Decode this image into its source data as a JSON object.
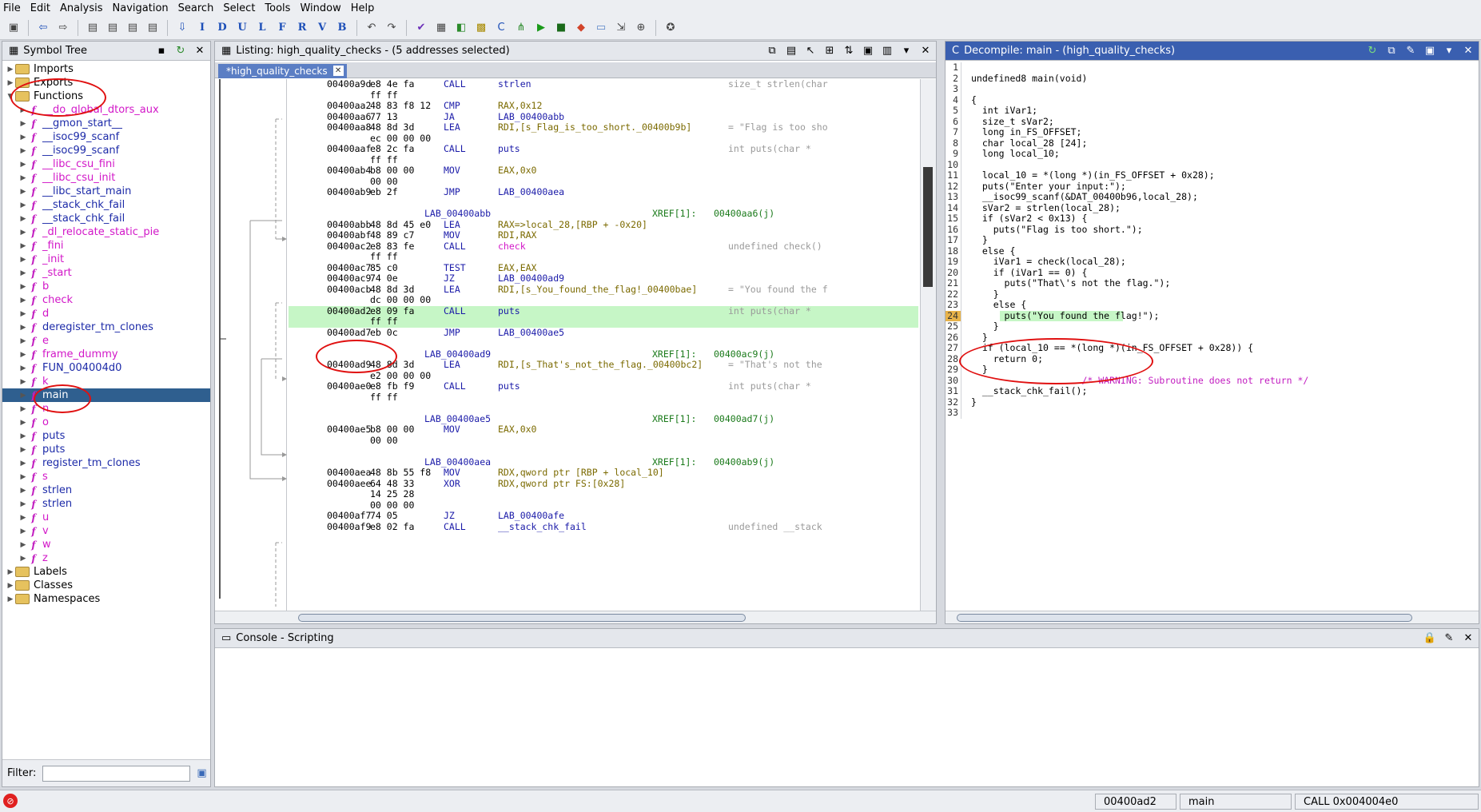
{
  "menu": [
    "File",
    "Edit",
    "Analysis",
    "Navigation",
    "Search",
    "Select",
    "Tools",
    "Window",
    "Help"
  ],
  "symbol_tree": {
    "title": "Symbol Tree",
    "folders_top": [
      "Imports",
      "Exports",
      "Functions"
    ],
    "functions": [
      {
        "name": "__do_global_dtors_aux",
        "color": "pink"
      },
      {
        "name": "__gmon_start__",
        "color": "navy"
      },
      {
        "name": "__isoc99_scanf",
        "color": "navy"
      },
      {
        "name": "__isoc99_scanf",
        "color": "navy"
      },
      {
        "name": "__libc_csu_fini",
        "color": "pink"
      },
      {
        "name": "__libc_csu_init",
        "color": "pink"
      },
      {
        "name": "__libc_start_main",
        "color": "navy"
      },
      {
        "name": "__stack_chk_fail",
        "color": "navy"
      },
      {
        "name": "__stack_chk_fail",
        "color": "navy"
      },
      {
        "name": "_dl_relocate_static_pie",
        "color": "pink"
      },
      {
        "name": "_fini",
        "color": "pink"
      },
      {
        "name": "_init",
        "color": "pink"
      },
      {
        "name": "_start",
        "color": "pink"
      },
      {
        "name": "b",
        "color": "pink"
      },
      {
        "name": "check",
        "color": "pink"
      },
      {
        "name": "d",
        "color": "pink"
      },
      {
        "name": "deregister_tm_clones",
        "color": "navy"
      },
      {
        "name": "e",
        "color": "pink"
      },
      {
        "name": "frame_dummy",
        "color": "pink"
      },
      {
        "name": "FUN_004004d0",
        "color": "navy"
      },
      {
        "name": "k",
        "color": "pink"
      },
      {
        "name": "main",
        "color": "sel"
      },
      {
        "name": "n",
        "color": "pink"
      },
      {
        "name": "o",
        "color": "pink"
      },
      {
        "name": "puts",
        "color": "navy"
      },
      {
        "name": "puts",
        "color": "navy"
      },
      {
        "name": "register_tm_clones",
        "color": "navy"
      },
      {
        "name": "s",
        "color": "pink"
      },
      {
        "name": "strlen",
        "color": "navy"
      },
      {
        "name": "strlen",
        "color": "navy"
      },
      {
        "name": "u",
        "color": "pink"
      },
      {
        "name": "v",
        "color": "pink"
      },
      {
        "name": "w",
        "color": "pink"
      },
      {
        "name": "z",
        "color": "pink"
      }
    ],
    "folders_bottom": [
      "Labels",
      "Classes",
      "Namespaces"
    ],
    "filter_label": "Filter:"
  },
  "listing": {
    "title": "Listing:  high_quality_checks - (5 addresses selected)",
    "tab": "*high_quality_checks",
    "lines": [
      {
        "a": "00400a9d",
        "b": "e8 4e fa",
        "m": "CALL",
        "o": "strlen",
        "c": "size_t strlen(char"
      },
      {
        "a": "",
        "b": "ff ff",
        "m": "",
        "o": "",
        "c": ""
      },
      {
        "a": "00400aa2",
        "b": "48 83 f8 12",
        "m": "CMP",
        "o": "RAX,0x12",
        "c": ""
      },
      {
        "a": "00400aa6",
        "b": "77 13",
        "m": "JA",
        "o": "LAB_00400abb",
        "c": ""
      },
      {
        "a": "00400aa8",
        "b": "48 8d 3d",
        "m": "LEA",
        "o": "RDI,[s_Flag_is_too_short._00400b9b]",
        "c": "= \"Flag is too sho"
      },
      {
        "a": "",
        "b": "ec 00 00 00",
        "m": "",
        "o": "",
        "c": ""
      },
      {
        "a": "00400aaf",
        "b": "e8 2c fa",
        "m": "CALL",
        "o": "puts",
        "c": "int puts(char *"
      },
      {
        "a": "",
        "b": "ff ff",
        "m": "",
        "o": "",
        "c": ""
      },
      {
        "a": "00400ab4",
        "b": "b8 00 00",
        "m": "MOV",
        "o": "EAX,0x0",
        "c": ""
      },
      {
        "a": "",
        "b": "00 00",
        "m": "",
        "o": "",
        "c": ""
      },
      {
        "a": "00400ab9",
        "b": "eb 2f",
        "m": "JMP",
        "o": "LAB_00400aea",
        "c": ""
      },
      {
        "blank": true
      },
      {
        "lab": "LAB_00400abb",
        "xr": "XREF[1]:",
        "xra": "00400aa6(j)"
      },
      {
        "a": "00400abb",
        "b": "48 8d 45 e0",
        "m": "LEA",
        "o": "RAX=>local_28,[RBP + -0x20]",
        "c": ""
      },
      {
        "a": "00400abf",
        "b": "48 89 c7",
        "m": "MOV",
        "o": "RDI,RAX",
        "c": ""
      },
      {
        "a": "00400ac2",
        "b": "e8 83 fe",
        "m": "CALL",
        "o": "check",
        "c": "undefined check()"
      },
      {
        "a": "",
        "b": "ff ff",
        "m": "",
        "o": "",
        "c": ""
      },
      {
        "a": "00400ac7",
        "b": "85 c0",
        "m": "TEST",
        "o": "EAX,EAX",
        "c": ""
      },
      {
        "a": "00400ac9",
        "b": "74 0e",
        "m": "JZ",
        "o": "LAB_00400ad9",
        "c": ""
      },
      {
        "a": "00400acb",
        "b": "48 8d 3d",
        "m": "LEA",
        "o": "RDI,[s_You_found_the_flag!_00400bae]",
        "c": "= \"You found the f"
      },
      {
        "a": "",
        "b": "dc 00 00 00",
        "m": "",
        "o": "",
        "c": ""
      },
      {
        "a": "00400ad2",
        "b": "e8 09 fa",
        "m": "CALL",
        "o": "puts",
        "c": "int puts(char *",
        "hl": true
      },
      {
        "a": "",
        "b": "ff ff",
        "m": "",
        "o": "",
        "c": "",
        "hl": true
      },
      {
        "a": "00400ad7",
        "b": "eb 0c",
        "m": "JMP",
        "o": "LAB_00400ae5",
        "c": ""
      },
      {
        "blank": true
      },
      {
        "lab": "LAB_00400ad9",
        "xr": "XREF[1]:",
        "xra": "00400ac9(j)"
      },
      {
        "a": "00400ad9",
        "b": "48 8d 3d",
        "m": "LEA",
        "o": "RDI,[s_That's_not_the_flag._00400bc2]",
        "c": "= \"That's not the"
      },
      {
        "a": "",
        "b": "e2 00 00 00",
        "m": "",
        "o": "",
        "c": ""
      },
      {
        "a": "00400ae0",
        "b": "e8 fb f9",
        "m": "CALL",
        "o": "puts",
        "c": "int puts(char *"
      },
      {
        "a": "",
        "b": "ff ff",
        "m": "",
        "o": "",
        "c": ""
      },
      {
        "blank": true
      },
      {
        "lab": "LAB_00400ae5",
        "xr": "XREF[1]:",
        "xra": "00400ad7(j)"
      },
      {
        "a": "00400ae5",
        "b": "b8 00 00",
        "m": "MOV",
        "o": "EAX,0x0",
        "c": ""
      },
      {
        "a": "",
        "b": "00 00",
        "m": "",
        "o": "",
        "c": ""
      },
      {
        "blank": true
      },
      {
        "lab": "LAB_00400aea",
        "xr": "XREF[1]:",
        "xra": "00400ab9(j)"
      },
      {
        "a": "00400aea",
        "b": "48 8b 55 f8",
        "m": "MOV",
        "o": "RDX,qword ptr [RBP + local_10]",
        "c": ""
      },
      {
        "a": "00400aee",
        "b": "64 48 33",
        "m": "XOR",
        "o": "RDX,qword ptr FS:[0x28]",
        "c": ""
      },
      {
        "a": "",
        "b": "14 25 28",
        "m": "",
        "o": "",
        "c": ""
      },
      {
        "a": "",
        "b": "00 00 00",
        "m": "",
        "o": "",
        "c": ""
      },
      {
        "a": "00400af7",
        "b": "74 05",
        "m": "JZ",
        "o": "LAB_00400afe",
        "c": ""
      },
      {
        "a": "00400af9",
        "b": "e8 02 fa",
        "m": "CALL",
        "o": "__stack_chk_fail",
        "c": "undefined __stack"
      }
    ]
  },
  "decompile": {
    "title": "Decompile: main -  (high_quality_checks)",
    "lines": [
      "",
      "undefined8 main(void)",
      "",
      "{",
      "  int iVar1;",
      "  size_t sVar2;",
      "  long in_FS_OFFSET;",
      "  char local_28 [24];",
      "  long local_10;",
      "",
      "  local_10 = *(long *)(in_FS_OFFSET + 0x28);",
      "  puts(\"Enter your input:\");",
      "  __isoc99_scanf(&DAT_00400b96,local_28);",
      "  sVar2 = strlen(local_28);",
      "  if (sVar2 < 0x13) {",
      "    puts(\"Flag is too short.\");",
      "  }",
      "  else {",
      "    iVar1 = check(local_28);",
      "    if (iVar1 == 0) {",
      "      puts(\"That\\'s not the flag.\");",
      "    }",
      "    else {",
      "      puts(\"You found the flag!\");",
      "    }",
      "  }",
      "  if (local_10 == *(long *)(in_FS_OFFSET + 0x28)) {",
      "    return 0;",
      "  }",
      "                    /* WARNING: Subroutine does not return */",
      "  __stack_chk_fail();",
      "}",
      ""
    ]
  },
  "console": {
    "title": "Console - Scripting"
  },
  "status": {
    "address": "00400ad2",
    "function": "main",
    "instruction": "CALL 0x004004e0"
  }
}
